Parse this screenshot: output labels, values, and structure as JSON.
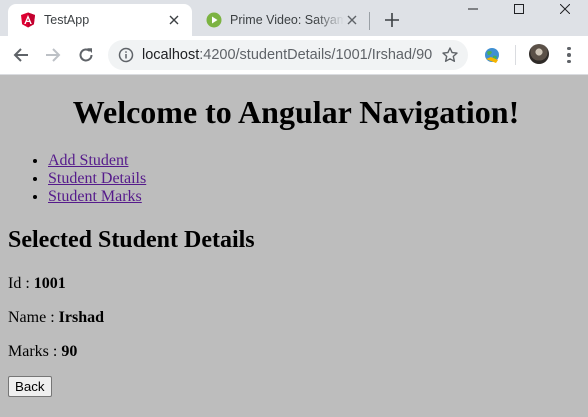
{
  "browser": {
    "tabs": [
      {
        "title": "TestApp",
        "favicon": "angular-icon",
        "active": true
      },
      {
        "title": "Prime Video: Satyameva Jayate",
        "favicon": "prime-video-icon",
        "active": false
      }
    ],
    "address": {
      "host": "localhost",
      "path": ":4200/studentDetails/1001/Irshad/90"
    }
  },
  "page": {
    "heading": "Welcome to Angular Navigation!",
    "nav": [
      "Add Student",
      "Student Details",
      "Student Marks"
    ],
    "section_title": "Selected Student Details",
    "details": [
      {
        "label": "Id : ",
        "value": "1001"
      },
      {
        "label": "Name : ",
        "value": "Irshad"
      },
      {
        "label": "Marks : ",
        "value": "90"
      }
    ],
    "back_label": "Back"
  },
  "colors": {
    "page_bg": "#bdbdbd",
    "link": "#551a8b",
    "tabbar_bg": "#dee1e6",
    "angular_red": "#dd0031",
    "prime_green": "#7cb342"
  }
}
